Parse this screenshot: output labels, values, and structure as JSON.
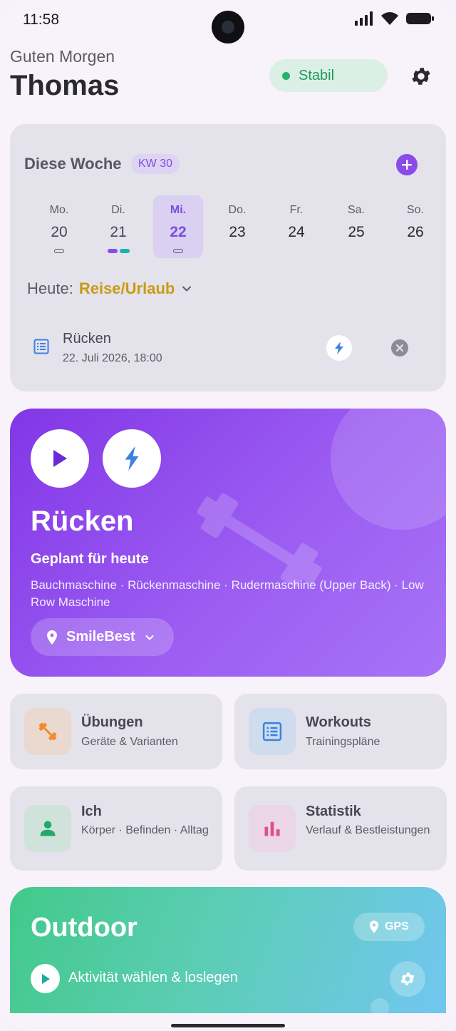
{
  "status_bar": {
    "time": "11:58"
  },
  "header": {
    "greeting": "Guten Morgen",
    "username": "Thomas",
    "status_label": "Stabil",
    "status_color": "#23b26b"
  },
  "week": {
    "title": "Diese Woche",
    "badge": "KW 30",
    "days": [
      {
        "name": "Mo.",
        "num": "20",
        "markers": [
          "outline"
        ]
      },
      {
        "name": "Di.",
        "num": "21",
        "markers": [
          "purple",
          "teal"
        ]
      },
      {
        "name": "Mi.",
        "num": "22",
        "markers": [
          "outline"
        ],
        "selected": true
      },
      {
        "name": "Do.",
        "num": "23",
        "markers": []
      },
      {
        "name": "Fr.",
        "num": "24",
        "markers": []
      },
      {
        "name": "Sa.",
        "num": "25",
        "markers": []
      },
      {
        "name": "So.",
        "num": "26",
        "markers": []
      }
    ],
    "today_label": "Heute:",
    "today_value": "Reise/Urlaub",
    "entry": {
      "title": "Rücken",
      "date": "22. Juli 2026, 18:00",
      "icon": "list-icon"
    }
  },
  "hero": {
    "title": "Rücken",
    "subtitle": "Geplant für heute",
    "exercises": "Bauchmaschine · Rückenmaschine · Rudermaschine (Upper Back) · Low Row Maschine",
    "location": "SmileBest",
    "accent": "#8236e6"
  },
  "tiles": {
    "exercises": {
      "title": "Übungen",
      "subtitle": "Geräte & Varianten",
      "icon": "dumbbell-icon"
    },
    "workouts": {
      "title": "Workouts",
      "subtitle": "Trainingspläne",
      "icon": "list-icon"
    },
    "me": {
      "title": "Ich",
      "subtitle": "Körper · Befinden · Alltag",
      "icon": "person-icon"
    },
    "stats": {
      "title": "Statistik",
      "subtitle": "Verlauf & Bestleistungen",
      "icon": "bar-chart-icon"
    }
  },
  "outdoor": {
    "title": "Outdoor",
    "gps_label": "GPS",
    "action": "Aktivität wählen & loslegen"
  }
}
